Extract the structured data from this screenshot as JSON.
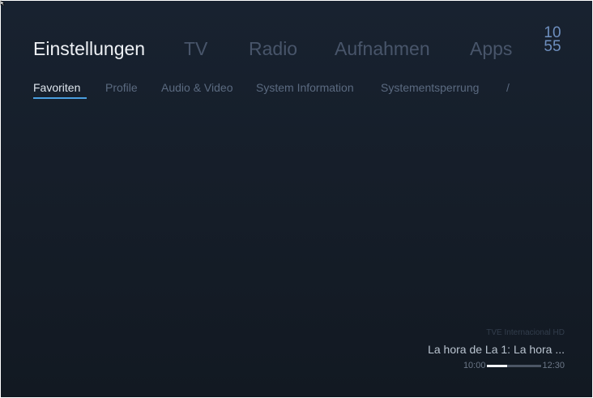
{
  "top_nav": {
    "items": [
      {
        "label": "Einstellungen",
        "active": true
      },
      {
        "label": "TV",
        "active": false
      },
      {
        "label": "Radio",
        "active": false
      },
      {
        "label": "Aufnahmen",
        "active": false
      },
      {
        "label": "Apps",
        "active": false
      }
    ]
  },
  "clock": {
    "hours": "10",
    "minutes": "55"
  },
  "sub_nav": {
    "items": [
      {
        "label": "Favoriten",
        "active": true
      },
      {
        "label": "Profile",
        "active": false
      },
      {
        "label": "Audio & Video",
        "active": false
      },
      {
        "label": "System Information",
        "active": false
      },
      {
        "label": "Systementsperrung",
        "active": false
      },
      {
        "label": "/",
        "active": false
      }
    ]
  },
  "now_playing": {
    "channel": "TVE Internacional HD",
    "program": "La hora de La 1: La hora ...",
    "start_time": "10:00",
    "end_time": "12:30",
    "progress_fraction": 0.37
  },
  "colors": {
    "background": "#172130",
    "accent": "#4a9fe0",
    "clock": "#6e8fbf"
  },
  "icons": {
    "cursor": "mouse-cursor-icon"
  }
}
